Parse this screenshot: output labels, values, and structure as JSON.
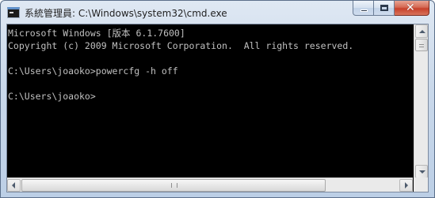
{
  "window": {
    "title": "系統管理員: C:\\Windows\\system32\\cmd.exe",
    "icon": "cmd-icon",
    "controls": {
      "minimize": "minimize-icon",
      "maximize": "maximize-icon",
      "close": "✕"
    }
  },
  "console": {
    "foreground": "#c0c0c0",
    "background": "#000000",
    "lines": [
      "Microsoft Windows [版本 6.1.7600]",
      "Copyright (c) 2009 Microsoft Corporation.  All rights reserved.",
      "",
      "C:\\Users\\joaoko>powercfg -h off",
      "",
      "C:\\Users\\joaoko>"
    ]
  },
  "scrollbars": {
    "vertical_position": 0,
    "horizontal_position": 0
  }
}
